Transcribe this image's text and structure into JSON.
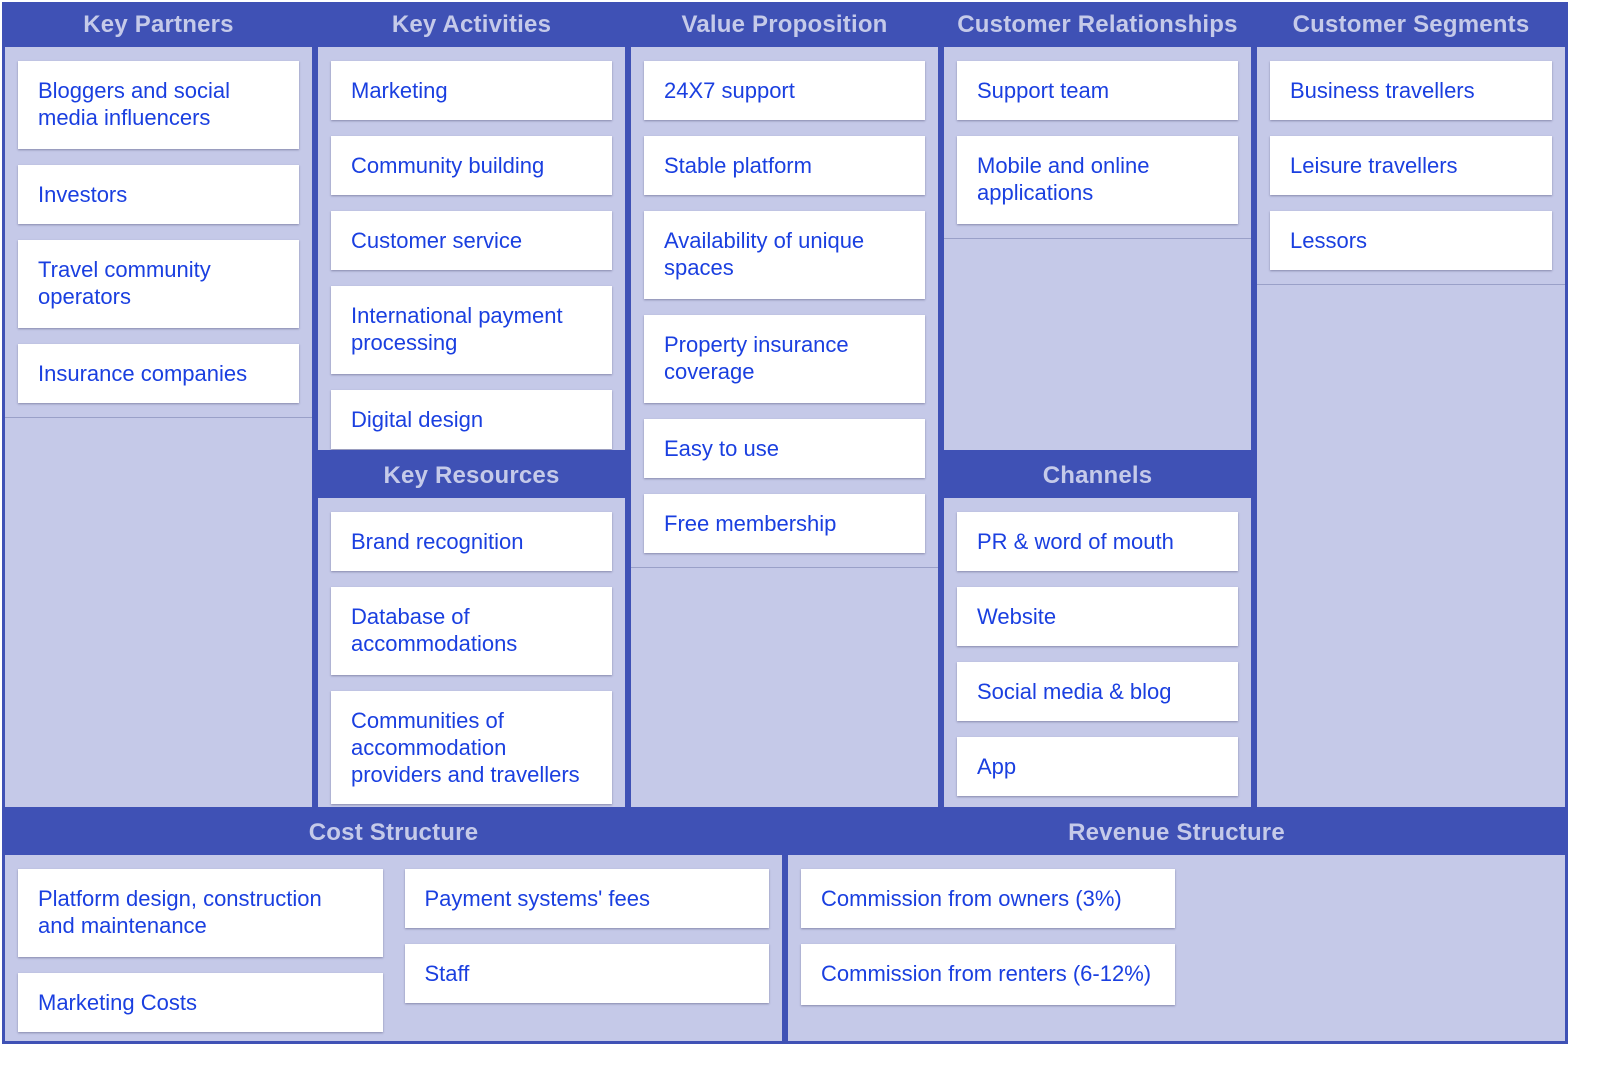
{
  "canvas": {
    "theme_colors": {
      "header_bg": "#3f51b5",
      "header_text": "#c5cae9",
      "panel_bg": "#c5c9e8",
      "card_bg": "#ffffff",
      "card_text": "#1a3fe0"
    },
    "key_partners": {
      "title": "Key Partners",
      "items": [
        "Bloggers and social media influencers",
        "Investors",
        "Travel community operators",
        "Insurance companies"
      ]
    },
    "key_activities": {
      "title": "Key Activities",
      "items": [
        "Marketing",
        "Community building",
        "Customer service",
        "International payment processing",
        "Digital design"
      ]
    },
    "key_resources": {
      "title": "Key Resources",
      "items": [
        "Brand recognition",
        "Database of accommodations",
        "Communities of accommodation providers and travellers"
      ]
    },
    "value_proposition": {
      "title": "Value Proposition",
      "items": [
        "24X7 support",
        "Stable platform",
        "Availability of unique spaces",
        "Property insurance coverage",
        "Easy to use",
        "Free membership"
      ]
    },
    "customer_relationships": {
      "title": "Customer Relationships",
      "items": [
        "Support team",
        "Mobile and online applications"
      ]
    },
    "channels": {
      "title": "Channels",
      "items": [
        "PR & word of mouth",
        "Website",
        "Social media & blog",
        "App"
      ]
    },
    "customer_segments": {
      "title": "Customer Segments",
      "items": [
        "Business travellers",
        "Leisure travellers",
        "Lessors"
      ]
    },
    "cost_structure": {
      "title": "Cost Structure",
      "columns": [
        [
          "Platform design, construction and maintenance",
          "Marketing Costs"
        ],
        [
          "Payment systems' fees",
          "Staff"
        ]
      ]
    },
    "revenue_structure": {
      "title": "Revenue Structure",
      "items": [
        "Commission from owners (3%)",
        "Commission from renters (6-12%)"
      ]
    }
  }
}
